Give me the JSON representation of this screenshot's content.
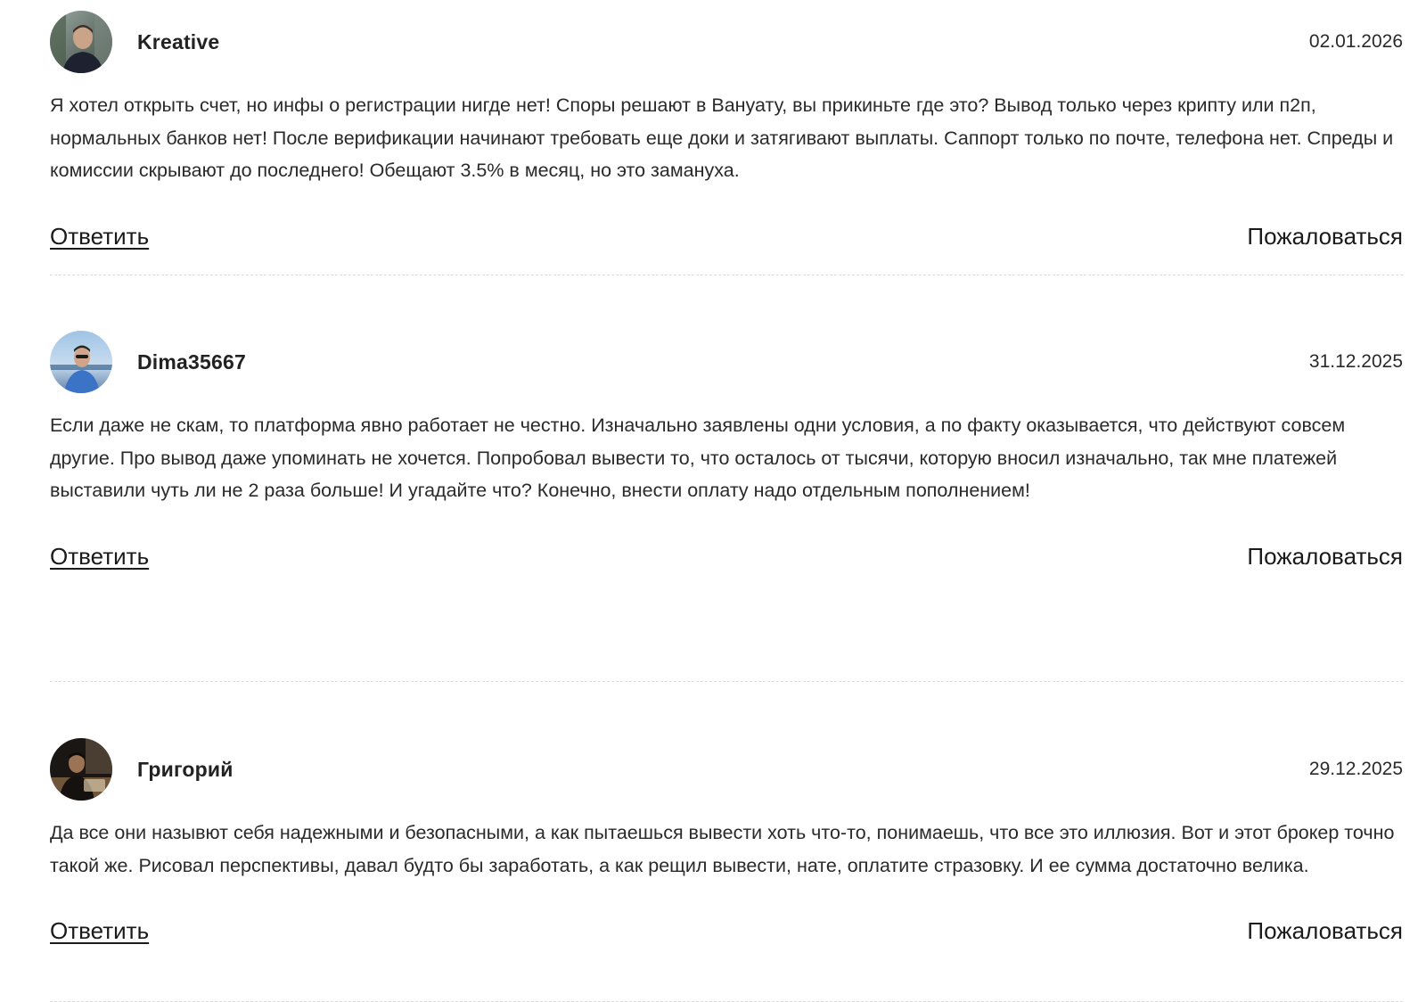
{
  "comments": [
    {
      "author": "Kreative",
      "date": "02.01.2026",
      "text": "Я хотел открыть счет, но инфы о регистрации нигде нет! Споры решают в Вануату, вы прикиньте где это? Вывод только через крипту или п2п, нормальных банков нет! После верификации начинают требовать еще доки и затягивают выплаты. Саппорт только по почте, телефона нет. Спреды и комиссии скрывают до последнего! Обещают 3.5% в месяц, но это замануха.",
      "reply_label": "Ответить",
      "report_label": "Пожаловаться"
    },
    {
      "author": "Dima35667",
      "date": "31.12.2025",
      "text": "Если даже не скам, то платформа явно работает не честно. Изначально заявлены одни условия, а по факту оказывается, что действуют совсем другие. Про вывод даже упоминать не хочется. Попробовал вывести то, что осталось от тысячи, которую вносил изначально, так мне платежей выставили чуть ли не 2 раза больше! И угадайте что? Конечно, внести оплату надо отдельным пополнением!",
      "reply_label": "Ответить",
      "report_label": "Пожаловаться"
    },
    {
      "author": "Григорий",
      "date": "29.12.2025",
      "text": "Да все они назывют себя надежными и безопасными, а как пытаешься вывести хоть что-то, понимаешь, что все это иллюзия. Вот и этот брокер точно такой же. Рисовал перспективы, давал будто бы заработать, а как рещил вывести, нате, оплатите стразовку. И ее сумма достаточно велика.",
      "reply_label": "Ответить",
      "report_label": "Пожаловаться"
    }
  ]
}
